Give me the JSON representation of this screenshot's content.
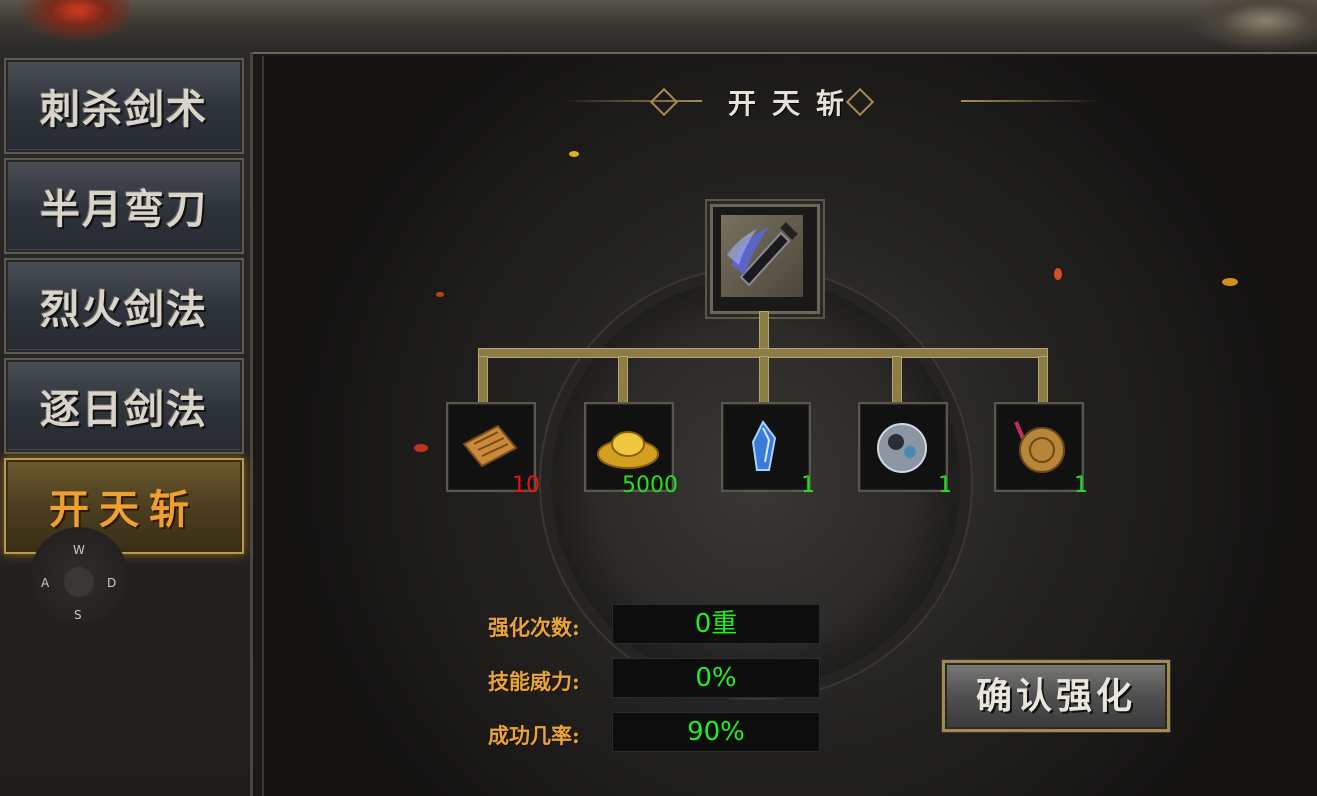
{
  "sidebar": {
    "tabs": [
      {
        "label": "刺杀剑术"
      },
      {
        "label": "半月弯刀"
      },
      {
        "label": "烈火剑法"
      },
      {
        "label": "逐日剑法"
      },
      {
        "label": "开天斩",
        "active": true
      }
    ]
  },
  "joystick": {
    "up": "W",
    "left": "A",
    "right": "D",
    "down": "S"
  },
  "panel": {
    "title": "开天斩",
    "skill_icon": "kaitianzhan-skill-icon"
  },
  "materials": [
    {
      "icon": "scroll-icon",
      "count": "10",
      "count_color": "#f01010"
    },
    {
      "icon": "gold-ingot-icon",
      "count": "5000",
      "count_color": "#20e020"
    },
    {
      "icon": "blue-crystal-icon",
      "count": "1",
      "count_color": "#20e020"
    },
    {
      "icon": "silver-orb-icon",
      "count": "1",
      "count_color": "#20e020"
    },
    {
      "icon": "bronze-medallion-icon",
      "count": "1",
      "count_color": "#20e020"
    }
  ],
  "stats": [
    {
      "label": "强化次数:",
      "value": "0重"
    },
    {
      "label": "技能威力:",
      "value": "0%"
    },
    {
      "label": "成功几率:",
      "value": "90%"
    }
  ],
  "confirm_button": {
    "label": "确认强化"
  },
  "colors": {
    "accent_gold": "#e8a43a",
    "value_green": "#22ee22",
    "count_red": "#f01010"
  }
}
